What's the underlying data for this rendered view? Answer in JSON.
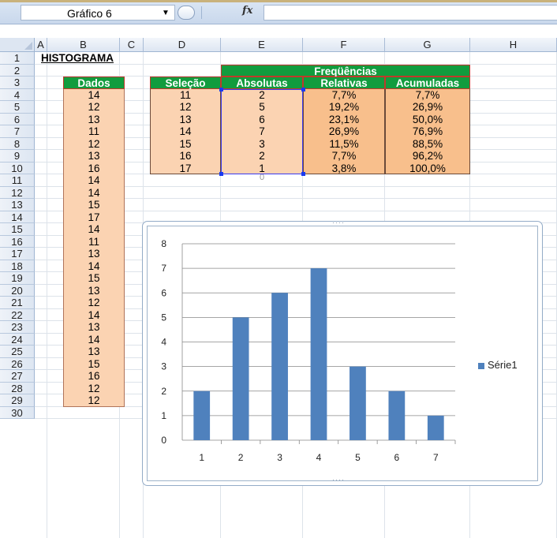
{
  "formula_bar": {
    "name_box": "Gráfico 6",
    "fx": "fx",
    "formula": ""
  },
  "columns": [
    "A",
    "B",
    "C",
    "D",
    "E",
    "F",
    "G",
    "H"
  ],
  "rows": [
    "1",
    "2",
    "3",
    "4",
    "5",
    "6",
    "7",
    "8",
    "9",
    "10",
    "11",
    "12",
    "13",
    "14",
    "15",
    "16",
    "17",
    "18",
    "19",
    "20",
    "21",
    "22",
    "23",
    "24",
    "25",
    "26",
    "27",
    "28",
    "29",
    "30"
  ],
  "sheet": {
    "title": "HISTOGRAMA",
    "frequencias_header": "Freqüências",
    "headers": {
      "dados": "Dados",
      "selecao": "Seleção",
      "absolutas": "Absolutas",
      "relativas": "Relativas",
      "acumuladas": "Acumuladas"
    },
    "dados": [
      "14",
      "12",
      "13",
      "11",
      "12",
      "13",
      "16",
      "14",
      "14",
      "15",
      "17",
      "14",
      "11",
      "13",
      "14",
      "15",
      "13",
      "12",
      "14",
      "13",
      "14",
      "13",
      "15",
      "16",
      "12",
      "12"
    ],
    "freq_table": [
      [
        "11",
        "2",
        "7,7%",
        "7,7%"
      ],
      [
        "12",
        "5",
        "19,2%",
        "26,9%"
      ],
      [
        "13",
        "6",
        "23,1%",
        "50,0%"
      ],
      [
        "14",
        "7",
        "26,9%",
        "76,9%"
      ],
      [
        "15",
        "3",
        "11,5%",
        "88,5%"
      ],
      [
        "16",
        "2",
        "7,7%",
        "96,2%"
      ],
      [
        "17",
        "1",
        "3,8%",
        "100,0%"
      ]
    ],
    "hidden_row_value": "0"
  },
  "chart_data": {
    "type": "bar",
    "categories": [
      "1",
      "2",
      "3",
      "4",
      "5",
      "6",
      "7"
    ],
    "series": [
      {
        "name": "Série1",
        "values": [
          2,
          5,
          6,
          7,
          3,
          2,
          1
        ],
        "color": "#4f81bd"
      }
    ],
    "ylim": [
      0,
      8
    ],
    "yticks": [
      "0",
      "1",
      "2",
      "3",
      "4",
      "5",
      "6",
      "7",
      "8"
    ],
    "grid": true,
    "legend": "right"
  }
}
